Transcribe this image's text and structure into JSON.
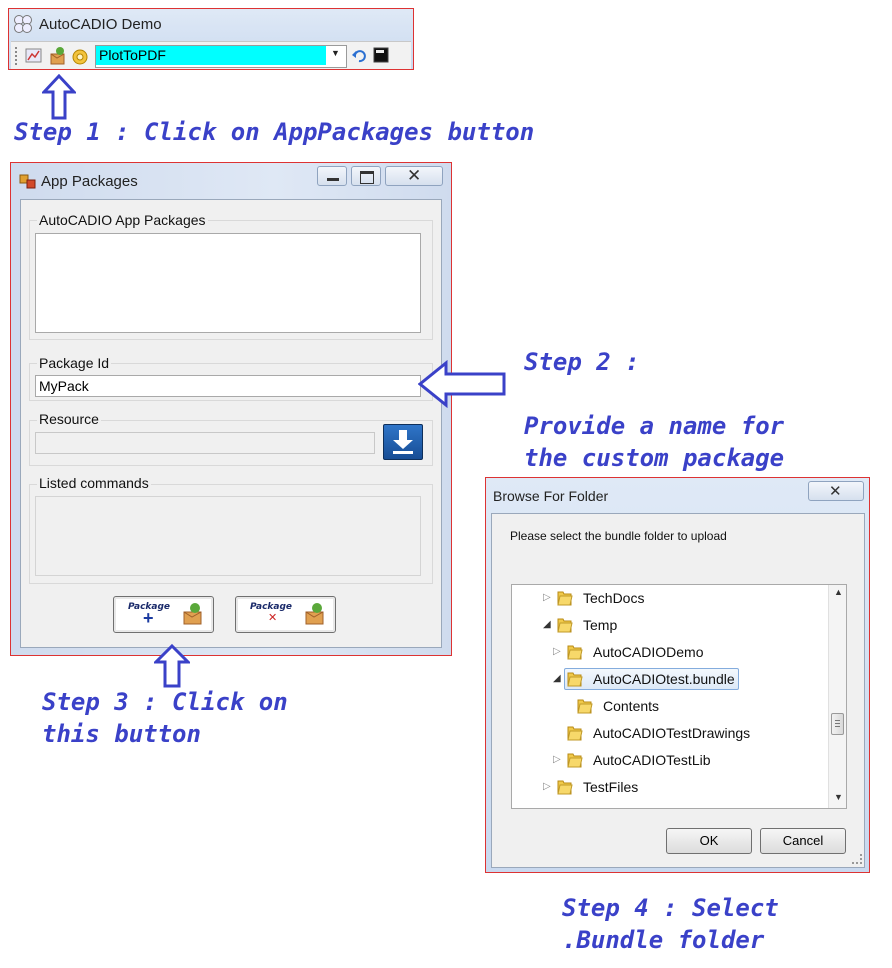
{
  "autocadio_window": {
    "title": "AutoCADIO Demo",
    "selected_command": "PlotToPDF"
  },
  "steps": {
    "step1": "Step 1 : Click on AppPackages button",
    "step2_line1": "Step 2 :",
    "step2_line2": "Provide a name for",
    "step2_line3": "the custom package",
    "step3_line1": "Step 3 : Click on",
    "step3_line2": "this button",
    "step4_line1": "Step 4 : Select",
    "step4_line2": ".Bundle folder"
  },
  "app_packages_window": {
    "title": "App Packages",
    "group_packages": "AutoCADIO App Packages",
    "group_package_id": "Package Id",
    "package_id_value": "MyPack",
    "group_resource": "Resource",
    "group_commands": "Listed commands",
    "add_button_label": "Package",
    "remove_button_label": "Package"
  },
  "browse_dialog": {
    "title": "Browse For Folder",
    "instruction": "Please select the bundle folder to upload",
    "tree": [
      {
        "label": "TechDocs",
        "expander": "collapsed"
      },
      {
        "label": "Temp",
        "expander": "expanded"
      },
      {
        "label": "AutoCADIODemo",
        "expander": "collapsed"
      },
      {
        "label": "AutoCADIOtest.bundle",
        "expander": "expanded",
        "selected": true
      },
      {
        "label": "Contents",
        "expander": "none"
      },
      {
        "label": "AutoCADIOTestDrawings",
        "expander": "none"
      },
      {
        "label": "AutoCADIOTestLib",
        "expander": "collapsed"
      },
      {
        "label": "TestFiles",
        "expander": "collapsed"
      }
    ],
    "ok_label": "OK",
    "cancel_label": "Cancel",
    "close_glyph": "✕"
  },
  "colors": {
    "annotation": "#3a41c8",
    "combo_highlight": "#00ffff",
    "border_red": "#dd3333",
    "download_button": "#1e5aa8"
  },
  "icons": {
    "app_window": "gear-cloud-icon",
    "arrow": "hollow-arrow",
    "download": "download-icon",
    "folder": "folder-icon"
  }
}
